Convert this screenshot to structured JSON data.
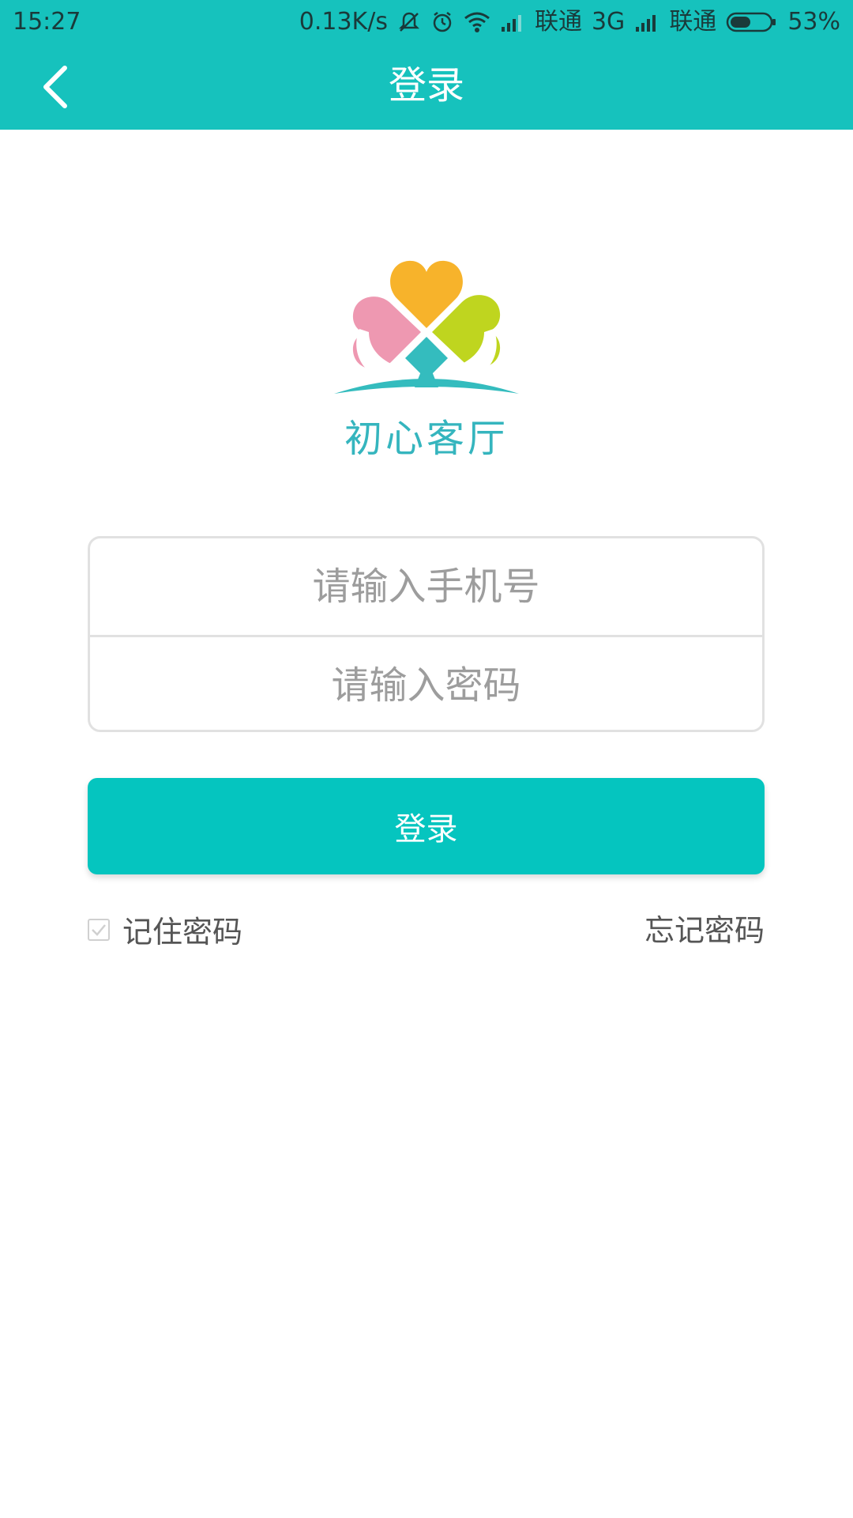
{
  "status_bar": {
    "time": "15:27",
    "net_speed": "0.13K/s",
    "carrier1": "联通",
    "network_type": "3G",
    "carrier2": "联通",
    "battery_percent": "53%",
    "battery_level": 0.53
  },
  "header": {
    "title": "登录",
    "background_color": "#16c2bd"
  },
  "logo": {
    "text": "初心客厅"
  },
  "form": {
    "phone_placeholder": "请输入手机号",
    "phone_value": "",
    "password_placeholder": "请输入密码",
    "password_value": ""
  },
  "login_button": {
    "label": "登录",
    "color": "#05c5bf"
  },
  "options": {
    "remember_label": "记住密码",
    "remember_checked": true,
    "forgot_label": "忘记密码"
  }
}
